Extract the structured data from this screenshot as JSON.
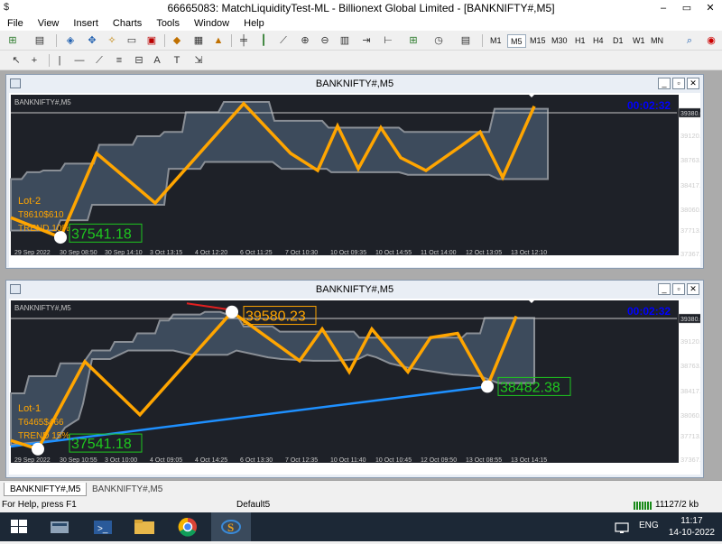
{
  "window": {
    "title": "66665083: MatchLiquidityTest-ML - Billionext Global Limited - [BANKNIFTY#,M5]",
    "minimize": "–",
    "restore": "▭",
    "close": "✕"
  },
  "menu": [
    "File",
    "View",
    "Insert",
    "Charts",
    "Tools",
    "Window",
    "Help"
  ],
  "timeframes": [
    "M1",
    "M5",
    "M15",
    "M30",
    "H1",
    "H4",
    "D1",
    "W1",
    "MN"
  ],
  "active_timeframe": "M5",
  "charts": [
    {
      "title": "BANKNIFTY#,M5",
      "symbol_label": "BANKNIFTY#,M5",
      "timer": "00:02:32",
      "price_scale": [
        "39467.40",
        "39120.50",
        "38763.90",
        "38417.40",
        "38060.60",
        "37713.90",
        "37367.40"
      ],
      "current_price": "39380.65",
      "time_labels": [
        "29 Sep 2022",
        "30 Sep 08:50",
        "30 Sep 14:10",
        "3 Oct 13:15",
        "4 Oct 12:20",
        "6 Oct 11:25",
        "7 Oct 10:30",
        "10 Oct 09:35",
        "10 Oct 14:55",
        "11 Oct 14:00",
        "12 Oct 13:05",
        "13 Oct 12:10"
      ],
      "lot_text": "Lot-2",
      "target_text": "T8610$610",
      "trend_text": "TREND 10%",
      "low_value": "37541.18",
      "high_value": "",
      "mid_value": ""
    },
    {
      "title": "BANKNIFTY#,M5",
      "symbol_label": "BANKNIFTY#,M5",
      "timer": "00:02:32",
      "price_scale": [
        "39467.40",
        "39120.50",
        "38763.90",
        "38417.40",
        "38060.60",
        "37713.90",
        "37367.40"
      ],
      "current_price": "39380.65",
      "time_labels": [
        "29 Sep 2022",
        "30 Sep 10:55",
        "3 Oct 10:00",
        "4 Oct 09:05",
        "4 Oct 14:25",
        "6 Oct 13:30",
        "7 Oct 12:35",
        "10 Oct 11:40",
        "10 Oct 10:45",
        "12 Oct 09:50",
        "13 Oct 08:55",
        "13 Oct 14:15"
      ],
      "lot_text": "Lot-1",
      "target_text": "T6465$466",
      "trend_text": "TREND 15%",
      "low_value": "37541.18",
      "high_value": "39580.23",
      "mid_value": "38482.38"
    }
  ],
  "tabs": [
    "BANKNIFTY#,M5",
    "BANKNIFTY#,M5"
  ],
  "status": {
    "help": "For Help, press F1",
    "profile": "Default5",
    "traffic": "11127/2 kb"
  },
  "taskbar": {
    "lang": "ENG",
    "time": "11:17",
    "date": "14-10-2022"
  },
  "colors": {
    "chart_bg": "#1e2128",
    "band": "#3d4b5c",
    "band_edge": "#8a8f96",
    "zigzag": "#ffa500",
    "trendline": "#1e90ff",
    "value_green": "#1fc81f",
    "value_orange": "#ffa500",
    "timer": "#0000ff"
  }
}
